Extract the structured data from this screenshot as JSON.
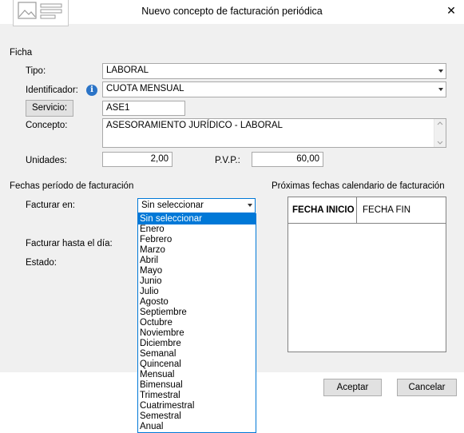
{
  "window": {
    "title": "Nuevo concepto de facturación periódica",
    "close_symbol": "✕"
  },
  "ficha": {
    "section": "Ficha",
    "tipo_label": "Tipo:",
    "tipo_value": "LABORAL",
    "identificador_label": "Identificador:",
    "identificador_value": "CUOTA MENSUAL",
    "info_symbol": "i",
    "servicio_button": "Servicio:",
    "servicio_value": "ASE1",
    "concepto_label": "Concepto:",
    "concepto_value": "ASESORAMIENTO JURÍDICO - LABORAL",
    "unidades_label": "Unidades:",
    "unidades_value": "2,00",
    "pvp_label": "P.V.P.:",
    "pvp_value": "60,00"
  },
  "periodo": {
    "section": "Fechas período de facturación",
    "facturar_en_label": "Facturar en:",
    "facturar_en_value": "Sin seleccionar",
    "facturar_hasta_label": "Facturar hasta el día:",
    "estado_label": "Estado:",
    "options": [
      "Sin seleccionar",
      "Enero",
      "Febrero",
      "Marzo",
      "Abril",
      "Mayo",
      "Junio",
      "Julio",
      "Agosto",
      "Septiembre",
      "Octubre",
      "Noviembre",
      "Diciembre",
      "Semanal",
      "Quincenal",
      "Mensual",
      "Bimensual",
      "Trimestral",
      "Cuatrimestral",
      "Semestral",
      "Anual"
    ]
  },
  "proximas": {
    "section": "Próximas fechas calendario de facturación",
    "col_inicio": "FECHA INICIO",
    "col_fin": "FECHA FIN"
  },
  "footer": {
    "accept": "Aceptar",
    "cancel": "Cancelar"
  }
}
